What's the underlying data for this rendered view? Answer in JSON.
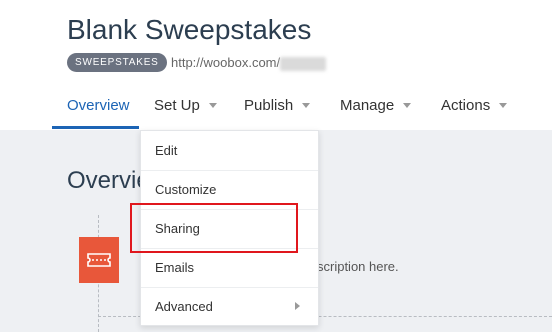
{
  "header": {
    "title": "Blank Sweepstakes",
    "type_badge": "SWEEPSTAKES",
    "url": "http://woobox.com/"
  },
  "tabs": [
    {
      "label": "Overview",
      "active": true,
      "has_caret": false
    },
    {
      "label": "Set Up",
      "active": false,
      "has_caret": true
    },
    {
      "label": "Publish",
      "active": false,
      "has_caret": true
    },
    {
      "label": "Manage",
      "active": false,
      "has_caret": true
    },
    {
      "label": "Actions",
      "active": false,
      "has_caret": true
    }
  ],
  "main": {
    "section_title": "Overview",
    "description_partial": "scription here.",
    "tile_icon": "ticket-icon",
    "tile_color": "#e8573a"
  },
  "setup_menu": {
    "items": [
      {
        "label": "Edit"
      },
      {
        "label": "Customize"
      },
      {
        "label": "Sharing",
        "highlighted": true
      },
      {
        "label": "Emails"
      },
      {
        "label": "Advanced",
        "submenu": true
      }
    ]
  },
  "colors": {
    "accent": "#1c64b5",
    "highlight_box": "#e0171d",
    "content_bg": "#eef0f3"
  }
}
